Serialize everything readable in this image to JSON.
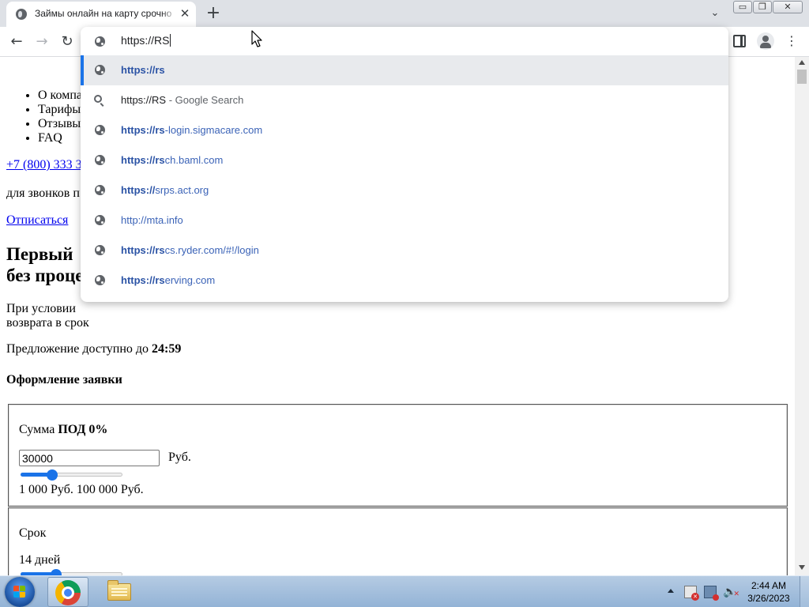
{
  "browser": {
    "tab": {
      "title": "Займы онлайн на карту срочно",
      "close": "✕"
    },
    "new_tab": "+",
    "tab_search": "⌄",
    "window": {
      "minimize": "▭",
      "maximize": "❐",
      "close": "✕"
    },
    "nav": {
      "back": "←",
      "forward": "→",
      "reload": "↻"
    },
    "menu": "⋮",
    "omnibox": {
      "typed": "https://RS",
      "suggestions": [
        {
          "icon": "globe-icon",
          "match": "https://rs",
          "rest": "",
          "selected": true
        },
        {
          "icon": "search-icon",
          "query": "https://RS",
          "suffix": " - Google Search"
        },
        {
          "icon": "globe-icon",
          "match": "https://rs",
          "rest": "-login.sigmacare.com"
        },
        {
          "icon": "globe-icon",
          "match": "https://rs",
          "rest": "ch.baml.com"
        },
        {
          "icon": "globe-icon",
          "match": "https://",
          "rest": "srps.act.org"
        },
        {
          "icon": "globe-icon",
          "match": "",
          "rest": "http://mta.info"
        },
        {
          "icon": "globe-icon",
          "match": "https://rs",
          "rest": "cs.ryder.com/#!/login"
        },
        {
          "icon": "globe-icon",
          "match": "https://rs",
          "rest": "erving.com"
        }
      ]
    }
  },
  "page": {
    "nav_items": [
      "О компа",
      "Тарифы",
      "Отзывы",
      "FAQ"
    ],
    "phone": "+7 (800) 333 3",
    "phone_note": "для звонков п",
    "unsubscribe": "Отписаться",
    "headline_line1": "Первый",
    "headline_line2": "без проце",
    "condition_line1": "При условии",
    "condition_line2": "возврата в срок",
    "offer_text": "Предложение доступно до ",
    "offer_time": "24:59",
    "form_title": "Оформление заявки",
    "amount": {
      "label": "Сумма ",
      "label_bold": "ПОД 0%",
      "value": "30000",
      "unit": "Руб.",
      "slider_fraction": 0.29,
      "range_text": "1 000 Руб. 100 000 Руб."
    },
    "term": {
      "label": "Срок",
      "value_text": "14 дней",
      "slider_fraction": 0.33
    }
  },
  "taskbar": {
    "clock_time": "2:44 AM",
    "clock_date": "3/26/2023"
  },
  "colors": {
    "url_match": "#2b53a5",
    "url_rest": "#3b63b7",
    "accent": "#1a73e8",
    "link": "#0000ee"
  }
}
